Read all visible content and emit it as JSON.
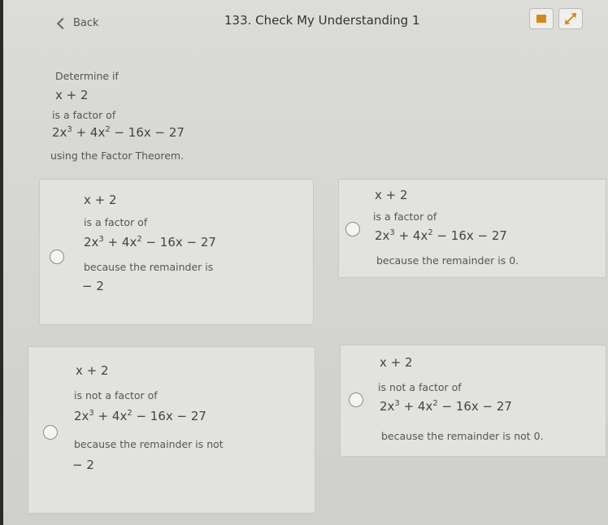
{
  "header": {
    "back_label": "Back",
    "title": "133. Check My Understanding 1"
  },
  "question": {
    "line1": "Determine if",
    "math1": "x + 2",
    "line2": "is a factor of",
    "poly": {
      "a": "2x",
      "b": "3",
      "c": " + 4x",
      "d": "2",
      "e": " − 16x − 27"
    },
    "line3": "using the Factor Theorem."
  },
  "options": [
    {
      "factor": "x + 2",
      "relation": "is a factor of",
      "because": "because the remainder is",
      "remainder": "− 2"
    },
    {
      "factor": "x + 2",
      "relation": "is a factor of",
      "because": "because the remainder is 0.",
      "remainder": ""
    },
    {
      "factor": "x + 2",
      "relation": "is not a factor of",
      "because": "because the remainder is not",
      "remainder": "− 2"
    },
    {
      "factor": "x + 2",
      "relation": "is not a factor of",
      "because": "because the remainder is not 0.",
      "remainder": ""
    }
  ],
  "colors": {
    "accent": "#d68a1c",
    "background": "#d6d6d2",
    "card": "#e2e2de"
  },
  "icons": [
    "chevron-left-icon",
    "book-icon",
    "expand-icon",
    "radio-button"
  ]
}
